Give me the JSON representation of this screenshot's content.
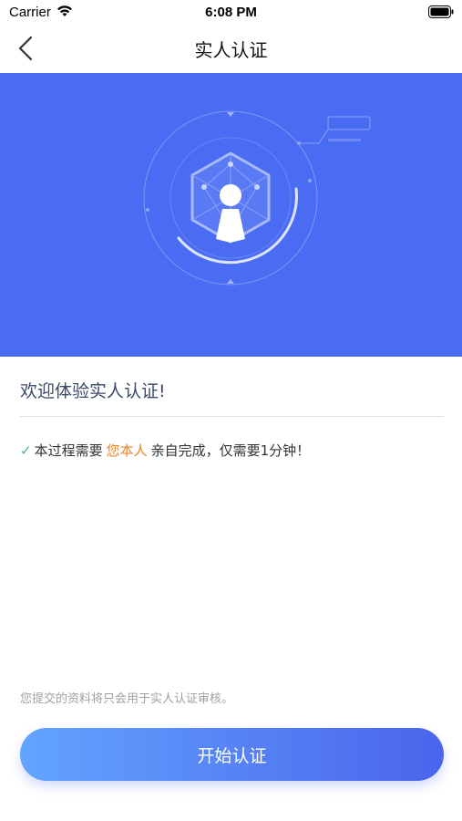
{
  "status_bar": {
    "carrier": "Carrier",
    "time": "6:08 PM"
  },
  "nav": {
    "title": "实人认证",
    "back_icon": "chevron-left-icon"
  },
  "hero": {
    "background": "#4a6cf2"
  },
  "welcome": {
    "title": "欢迎体验实人认证!"
  },
  "notice": {
    "check_icon": "checkmark-icon",
    "prefix": "本过程需要",
    "highlight": "您本人",
    "suffix": "亲自完成，仅需要1分钟！",
    "highlight_color": "#f0831e"
  },
  "privacy": {
    "text": "您提交的资料将只会用于实人认证审核。"
  },
  "actions": {
    "start_label": "开始认证"
  }
}
